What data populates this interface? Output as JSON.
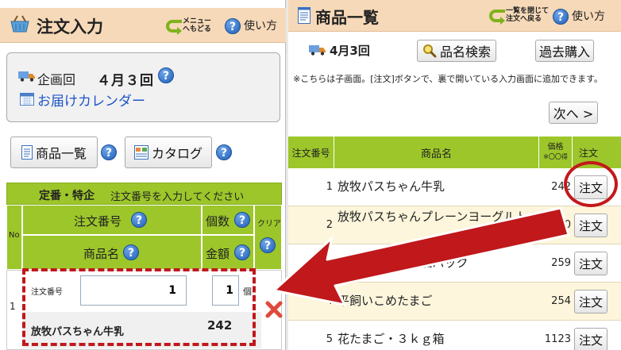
{
  "left": {
    "title": "注文入力",
    "menu_back": [
      "メニュー",
      "へもどる"
    ],
    "usage": "使い方",
    "plan_label": "企画回",
    "plan_value": "４月３回",
    "calendar_link": "お届けカレンダー",
    "product_list_button": "商品一覧",
    "catalog_button": "カタログ",
    "order_table": {
      "header_main": "定番・特企",
      "header_hint": "注文番号を入力してください",
      "col_no": "No",
      "col_order_no": "注文番号",
      "col_qty": "個数",
      "col_clear": "クリア",
      "col_product": "商品名",
      "col_amount": "金額",
      "row": {
        "no": "1",
        "order_no_label": "注文番号",
        "order_no_value": "1",
        "qty_value": "1",
        "qty_unit": "個",
        "product_name": "放牧パスちゃん牛乳",
        "price": "242"
      }
    }
  },
  "right": {
    "title": "商品一覧",
    "close_back": [
      "一覧を閉じて",
      "注文へ戻る"
    ],
    "usage": "使い方",
    "plan": "4月3回",
    "search_button": "品名検索",
    "past_button": "過去購入",
    "notice": "※こちらは子画面。[注文]ボタンで、裏で開いている入力画面に追加できます。",
    "next_button": "次へ >",
    "columns": {
      "order_no": "注文番号",
      "product": "商品名",
      "price": [
        "価格",
        "※〇〇得"
      ],
      "order": "注文"
    },
    "rows": [
      {
        "no": "1",
        "name": "放牧パスちゃん牛乳",
        "price": "242",
        "button": "注文"
      },
      {
        "no": "2",
        "name": "放牧パスちゃんプレーンヨーグルト",
        "price": "220",
        "button": "注文"
      },
      {
        "no": "3",
        "name": "花たまご・１０個パック",
        "price": "259",
        "button": "注文"
      },
      {
        "no": "4",
        "name": "平飼いこめたまご",
        "price": "254",
        "button": "注文"
      },
      {
        "no": "5",
        "name": "花たまご・３ｋｇ箱",
        "price": "1123",
        "button": "注文"
      }
    ]
  },
  "colors": {
    "header_bg": "#f6d9b8",
    "table_green": "#9cc62a",
    "annotation_red": "#c0181b",
    "link_blue": "#1f57c8"
  }
}
